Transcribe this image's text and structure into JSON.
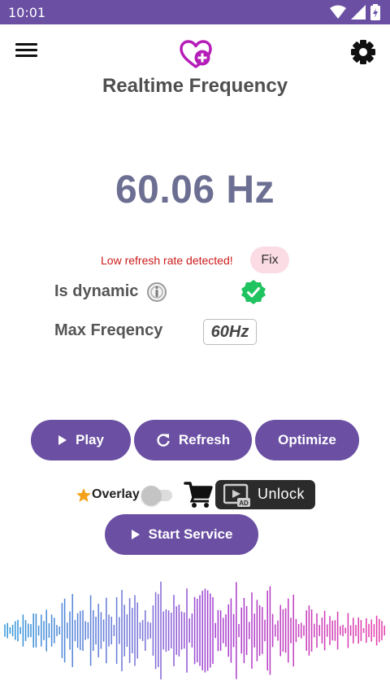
{
  "status_bar": {
    "time": "10:01",
    "icons": [
      "wifi-icon",
      "signal-icon",
      "battery-icon"
    ]
  },
  "header": {
    "title": "Realtime Frequency",
    "menu_icon": "hamburger-menu-icon",
    "settings_icon": "gear-icon",
    "logo_icon": "heart-plus-icon"
  },
  "frequency": {
    "value": "60.06 Hz"
  },
  "warning": {
    "text": "Low refresh rate detected!",
    "fix_label": "Fix"
  },
  "rows": {
    "dynamic_label": "Is dynamic",
    "dynamic_state": "enabled",
    "max_label": "Max Freqency",
    "max_value": "60Hz"
  },
  "actions": {
    "play_label": "Play",
    "refresh_label": "Refresh",
    "optimize_label": "Optimize",
    "start_label": "Start Service"
  },
  "overlay": {
    "label": "Overlay",
    "enabled": false,
    "unlock_label": "Unlock",
    "ad_badge": "AD"
  },
  "colors": {
    "primary": "#6a4fa3",
    "frequency_text": "#6c6f92",
    "warning_text": "#cc1b1b",
    "fix_background": "#fbdce4",
    "check_green": "#1fc35f",
    "wave_start": "#2a97d8",
    "wave_end": "#e63aa8"
  }
}
